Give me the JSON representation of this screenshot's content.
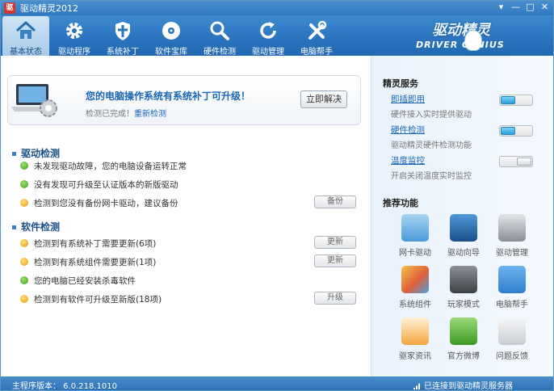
{
  "window": {
    "title": "驱动精灵2012",
    "logo_char": "驱",
    "controls": [
      "▾",
      "—",
      "□",
      "✕"
    ]
  },
  "toolbar": {
    "items": [
      {
        "label": "基本状态",
        "icon": "home-icon",
        "active": true
      },
      {
        "label": "驱动程序",
        "icon": "gear-icon",
        "active": false
      },
      {
        "label": "系统补丁",
        "icon": "shield-icon",
        "active": false
      },
      {
        "label": "软件宝库",
        "icon": "disc-icon",
        "active": false
      },
      {
        "label": "硬件检测",
        "icon": "magnifier-icon",
        "active": false
      },
      {
        "label": "驱动管理",
        "icon": "refresh-icon",
        "active": false
      },
      {
        "label": "电脑帮手",
        "icon": "tools-icon",
        "active": false
      }
    ],
    "brand_cn": "驱动精灵",
    "brand_en": "DRIVER  GENIUS"
  },
  "alert": {
    "title": "您的电脑操作系统有系统补丁可升级！",
    "sub_prefix": "检测已完成！",
    "sub_link": "重新检测",
    "button": "立即解决"
  },
  "driver_check": {
    "title": "驱动检测",
    "rows": [
      {
        "status": "ok",
        "text": "未发现驱动故障，您的电脑设备运转正常",
        "button": ""
      },
      {
        "status": "ok",
        "text": "没有发现可升级至认证版本的新版驱动",
        "button": ""
      },
      {
        "status": "warn",
        "text": "检测到您没有备份网卡驱动，建议备份",
        "button": "备份"
      }
    ]
  },
  "software_check": {
    "title": "软件检测",
    "rows": [
      {
        "status": "warn",
        "text": "检测到有系统补丁需要更新(6项)",
        "button": "更新"
      },
      {
        "status": "warn",
        "text": "检测到有系统组件需要更新(1项)",
        "button": "更新"
      },
      {
        "status": "ok",
        "text": "您的电脑已经安装杀毒软件",
        "button": ""
      },
      {
        "status": "warn",
        "text": "检测到有软件可升级至新版(18项)",
        "button": "升级"
      }
    ]
  },
  "services": {
    "title": "精灵服务",
    "items": [
      {
        "name": "即插即用",
        "desc": "硬件接入实时提供驱动",
        "on": true
      },
      {
        "name": "硬件检测",
        "desc": "驱动精灵硬件检测功能",
        "on": true
      },
      {
        "name": "温度监控",
        "desc": "开启关闭温度实时监控",
        "on": false
      }
    ]
  },
  "recommended": {
    "title": "推荐功能",
    "tiles": [
      {
        "label": "网卡驱动",
        "icon": "network-card-icon",
        "color": "#4a9bd8"
      },
      {
        "label": "驱动向导",
        "icon": "wizard-search-icon",
        "color": "#2a6fb1"
      },
      {
        "label": "驱动管理",
        "icon": "gears-manage-icon",
        "color": "#8a8f96"
      },
      {
        "label": "系统组件",
        "icon": "components-icon",
        "color": "#e0603a"
      },
      {
        "label": "玩家模式",
        "icon": "sliders-icon",
        "color": "#5a5f66"
      },
      {
        "label": "电脑帮手",
        "icon": "users-help-icon",
        "color": "#2f7fd0"
      },
      {
        "label": "驱家资讯",
        "icon": "news-icon",
        "color": "#f3a53a"
      },
      {
        "label": "官方微博",
        "icon": "weibo-chat-icon",
        "color": "#59b13a"
      },
      {
        "label": "问题反馈",
        "icon": "feedback-mail-icon",
        "color": "#c8ccd1"
      }
    ]
  },
  "statusbar": {
    "version": "主程序版本： 6.0.218.1010",
    "connection": "已连接到驱动精灵服务器"
  }
}
